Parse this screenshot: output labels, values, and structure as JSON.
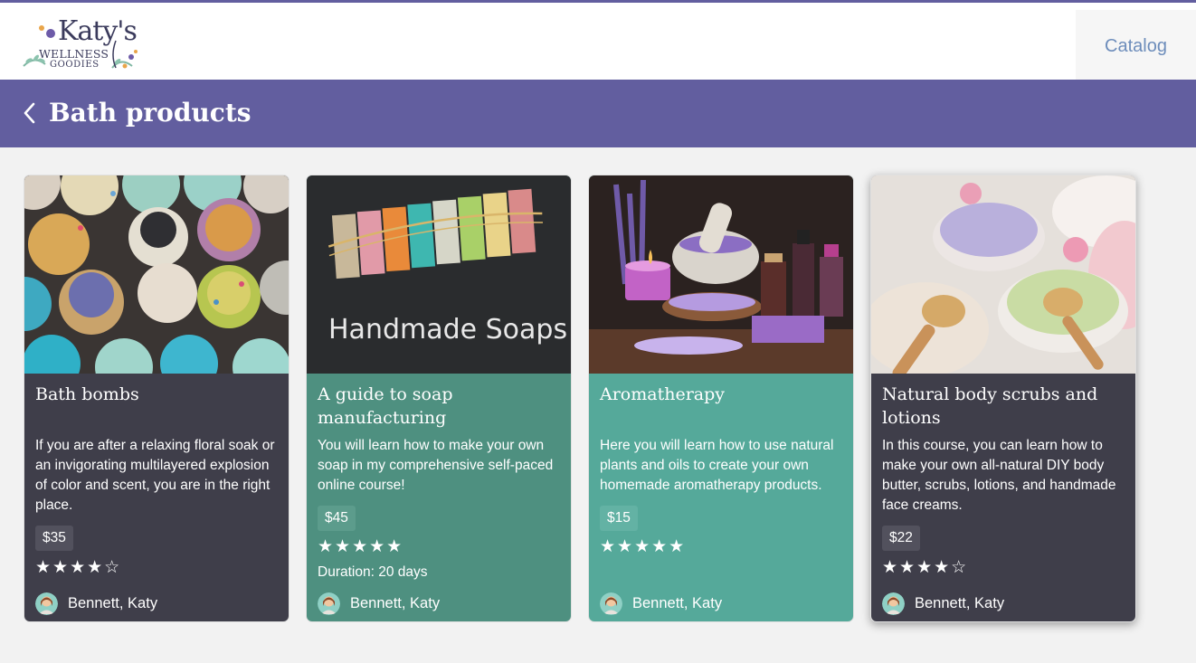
{
  "header": {
    "logo_main": "Katy's",
    "logo_line2": "WELLNESS",
    "logo_line3": "GOODIES",
    "catalog_label": "Catalog"
  },
  "title_bar": {
    "title": "Bath products"
  },
  "colors": {
    "accent_purple": "#625e9f",
    "card_dark": "#3f3e4a",
    "card_teal_dark": "#4e9080",
    "card_teal": "#55a99a"
  },
  "courses": [
    {
      "title": "Bath bombs",
      "description": "If you are after a relaxing floral soak or an invigorating multilayered explosion of color and scent, you are in the right place.",
      "price": "$35",
      "stars": "★★★★☆",
      "rating": 4,
      "duration": "",
      "author": "Bennett, Katy"
    },
    {
      "title": "A guide to soap manufacturing",
      "description": "You will learn how to make your own soap in my comprehensive self-paced online course!",
      "price": "$45",
      "stars": "★★★★★",
      "rating": 5,
      "duration": "Duration: 20 days",
      "author": "Bennett, Katy",
      "image_caption": "Handmade Soaps"
    },
    {
      "title": "Aromatherapy",
      "description": "Here you will learn how to use natural plants and oils to create your own homemade aromatherapy products.",
      "price": "$15",
      "stars": "★★★★★",
      "rating": 5,
      "duration": "",
      "author": "Bennett, Katy"
    },
    {
      "title": "Natural body scrubs and lotions",
      "description": "In this course, you can learn how to make your own all-natural DIY body butter, scrubs, lotions, and handmade face creams.",
      "price": "$22",
      "stars": "★★★★☆",
      "rating": 4,
      "duration": "",
      "author": "Bennett, Katy"
    }
  ]
}
